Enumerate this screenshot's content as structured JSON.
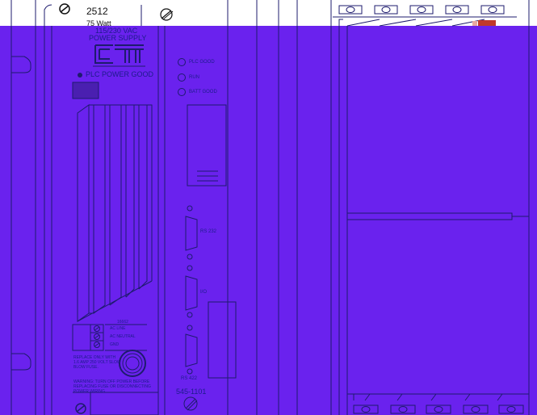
{
  "colors": {
    "fill": "#6a22ee",
    "line": "#1e1b6e",
    "top_bg": "#ffffff",
    "ink": "#111111"
  },
  "top_label": {
    "model": "2512",
    "wattage": "75 Watt"
  },
  "power_supply": {
    "voltage": "115/230 VAC",
    "name": "POWER SUPPLY",
    "logo": "CTI",
    "power_good": "PLC POWER GOOD",
    "terminal_block": {
      "header": "16662",
      "rows": [
        "AC LINE",
        "AC NEUTRAL",
        "GND"
      ]
    },
    "fuse_note": "REPLACE ONLY WITH 1.6 AMP 250 VOLT SLOW BLOW FUSE.",
    "warning": "WARNING: TURN OFF POWER BEFORE REPLACING FUSE OR DISCONNECTING POWER WIRING."
  },
  "cpu": {
    "status_leds": [
      "PLC GOOD",
      "RUN",
      "BATT GOOD"
    ],
    "ports": [
      "RS 232",
      "I/O",
      "RS 422"
    ],
    "part_number": "545-1101"
  },
  "icons": [
    "screw-icon",
    "slot-screw-icon",
    "led-icon",
    "db-connector-icon",
    "terminal-screw-icon",
    "fuse-holder-icon"
  ]
}
